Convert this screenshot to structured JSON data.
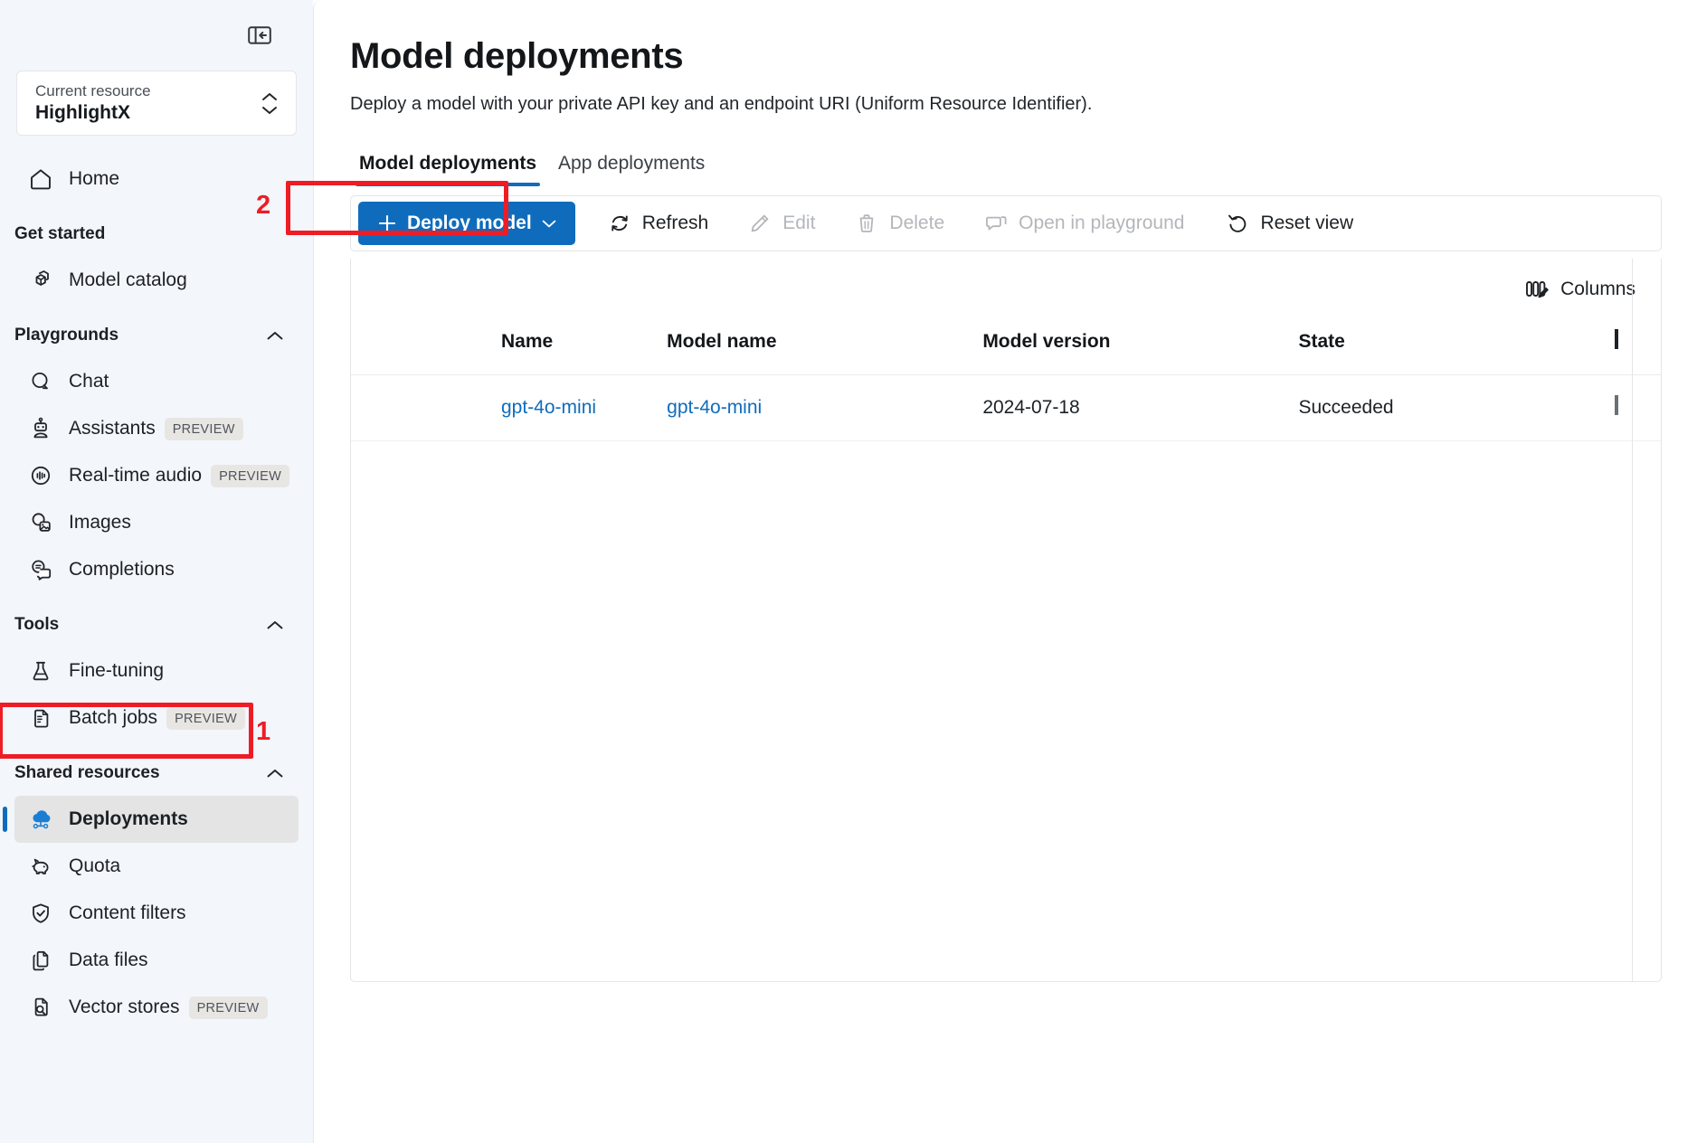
{
  "sidebar": {
    "collapse_icon": "panel-collapse-icon",
    "resource": {
      "label": "Current resource",
      "value": "HighlightX",
      "chevron_icon": "chevron-up-down-icon"
    },
    "home": {
      "label": "Home",
      "icon": "home-icon"
    },
    "groups": [
      {
        "title": "Get started",
        "collapsible": false,
        "items": [
          {
            "label": "Model catalog",
            "icon": "cube-icon",
            "badge": "",
            "selected": false
          }
        ]
      },
      {
        "title": "Playgrounds",
        "collapsible": true,
        "items": [
          {
            "label": "Chat",
            "icon": "chat-icon",
            "badge": "",
            "selected": false
          },
          {
            "label": "Assistants",
            "icon": "robot-icon",
            "badge": "PREVIEW",
            "selected": false
          },
          {
            "label": "Real-time audio",
            "icon": "audio-wave-icon",
            "badge": "PREVIEW",
            "selected": false
          },
          {
            "label": "Images",
            "icon": "image-chat-icon",
            "badge": "",
            "selected": false
          },
          {
            "label": "Completions",
            "icon": "completions-icon",
            "badge": "",
            "selected": false
          }
        ]
      },
      {
        "title": "Tools",
        "collapsible": true,
        "items": [
          {
            "label": "Fine-tuning",
            "icon": "flask-icon",
            "badge": "",
            "selected": false
          },
          {
            "label": "Batch jobs",
            "icon": "batch-doc-icon",
            "badge": "PREVIEW",
            "selected": false
          }
        ]
      },
      {
        "title": "Shared resources",
        "collapsible": true,
        "items": [
          {
            "label": "Deployments",
            "icon": "deployments-cloud-icon",
            "badge": "",
            "selected": true
          },
          {
            "label": "Quota",
            "icon": "piggy-bank-icon",
            "badge": "",
            "selected": false
          },
          {
            "label": "Content filters",
            "icon": "shield-check-icon",
            "badge": "",
            "selected": false
          },
          {
            "label": "Data files",
            "icon": "documents-icon",
            "badge": "",
            "selected": false
          },
          {
            "label": "Vector stores",
            "icon": "doc-search-icon",
            "badge": "PREVIEW",
            "selected": false
          }
        ]
      }
    ]
  },
  "main": {
    "title": "Model deployments",
    "subtitle": "Deploy a model with your private API key and an endpoint URI (Uniform Resource Identifier).",
    "tabs": [
      {
        "label": "Model deployments",
        "active": true
      },
      {
        "label": "App deployments",
        "active": false
      }
    ],
    "toolbar": {
      "deploy_model": {
        "label": "Deploy model",
        "icon": "plus-icon",
        "chevron": "chevron-down-icon",
        "disabled": false
      },
      "refresh": {
        "label": "Refresh",
        "icon": "refresh-icon",
        "disabled": false
      },
      "edit": {
        "label": "Edit",
        "icon": "pencil-icon",
        "disabled": true
      },
      "delete": {
        "label": "Delete",
        "icon": "trash-icon",
        "disabled": true
      },
      "open_in_playground": {
        "label": "Open in playground",
        "icon": "playground-icon",
        "disabled": true
      },
      "reset_view": {
        "label": "Reset view",
        "icon": "reset-arrow-icon",
        "disabled": false
      }
    },
    "columns_button": {
      "label": "Columns",
      "icon": "columns-edit-icon"
    },
    "table": {
      "headers": [
        "Name",
        "Model name",
        "Model version",
        "State"
      ],
      "rows": [
        {
          "name": "gpt-4o-mini",
          "model_name": "gpt-4o-mini",
          "model_version": "2024-07-18",
          "state": "Succeeded"
        }
      ]
    }
  },
  "annotations": [
    {
      "number": "1",
      "target": "sidebar-item-deployments"
    },
    {
      "number": "2",
      "target": "deploy-model-button"
    }
  ],
  "colors": {
    "accent": "#0f6cbd",
    "annotation": "#ee1c25",
    "sidebar_bg": "#f3f6fb",
    "selected_bg": "#e4e4e4"
  }
}
